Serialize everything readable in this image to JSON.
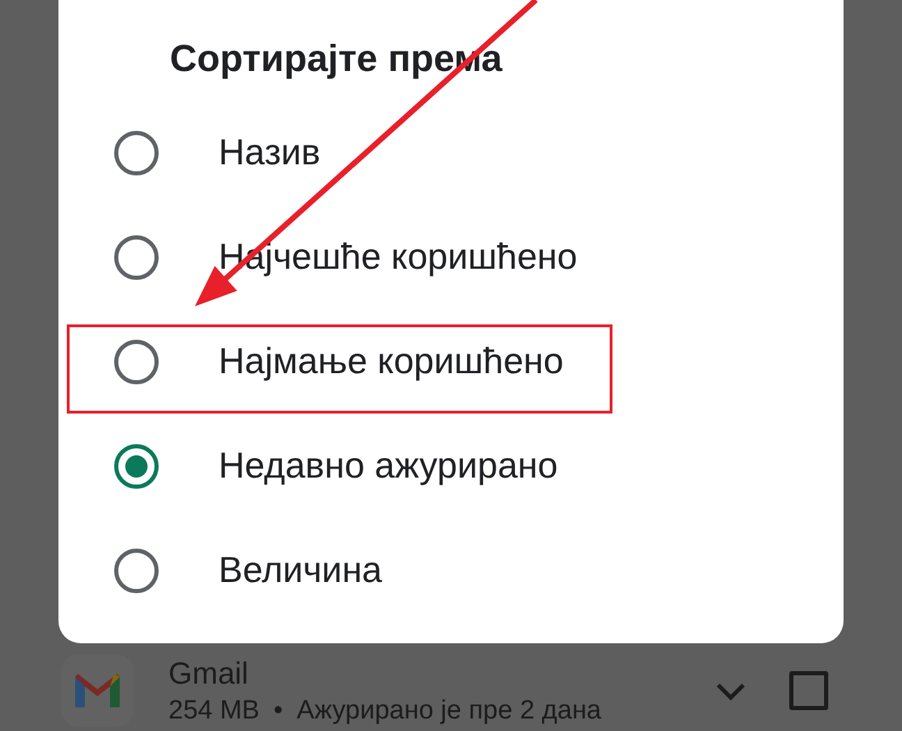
{
  "dialog": {
    "title": "Сортирајте према",
    "options": [
      {
        "label": "Назив",
        "selected": false,
        "highlighted": false
      },
      {
        "label": "Најчешће коришћено",
        "selected": false,
        "highlighted": false
      },
      {
        "label": "Најмање коришћено",
        "selected": false,
        "highlighted": true
      },
      {
        "label": "Недавно ажурирано",
        "selected": true,
        "highlighted": false
      },
      {
        "label": "Величина",
        "selected": false,
        "highlighted": false
      }
    ]
  },
  "app_row": {
    "name": "Gmail",
    "size": "254 MB",
    "separator": "•",
    "updated": "Ажурирано је пре 2 дана",
    "checked": false
  }
}
